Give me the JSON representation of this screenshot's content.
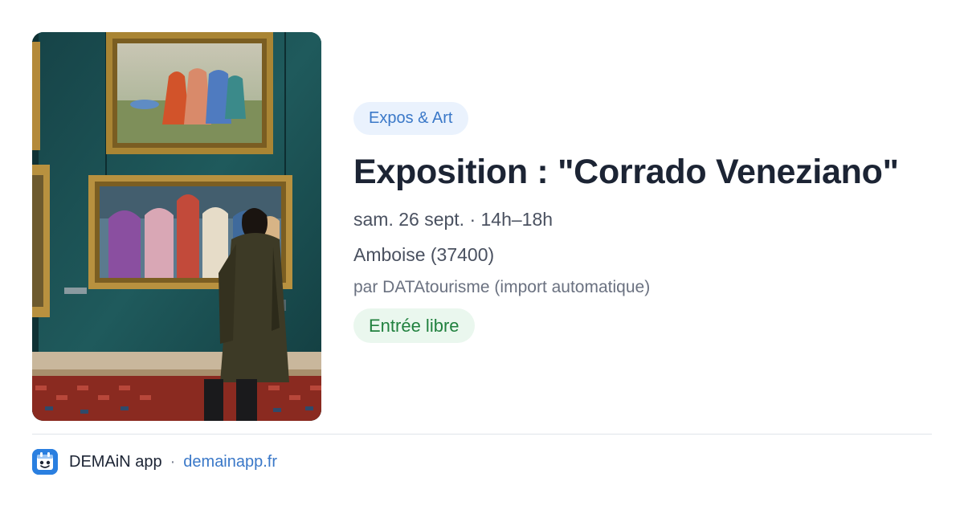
{
  "event": {
    "category": "Expos & Art",
    "title": "Exposition : \"Corrado Veneziano\"",
    "when": "sam. 26 sept. · 14h–18h",
    "where": "Amboise (37400)",
    "by": "par DATAtourisme (import automatique)",
    "price": "Entrée libre"
  },
  "footer": {
    "app_name": "DEMAiN app",
    "separator": "·",
    "site": "demainapp.fr"
  },
  "colors": {
    "category_bg": "#eaf2fd",
    "category_text": "#3a78c8",
    "price_bg": "#eaf7ee",
    "price_text": "#21813f",
    "link": "#3a78c8",
    "app_icon": "#2a7fe0"
  },
  "icons": {
    "app": "app-logo-icon"
  }
}
